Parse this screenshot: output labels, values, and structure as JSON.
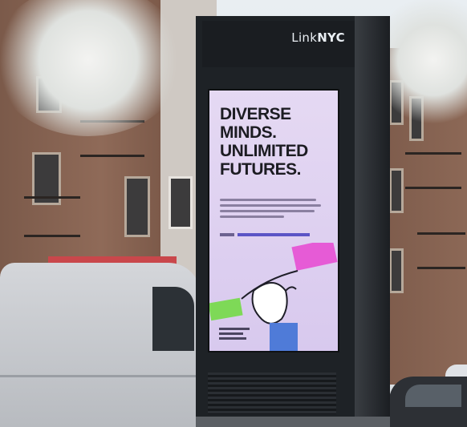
{
  "kiosk": {
    "brand_link": "Link",
    "brand_nyc": "NYC"
  },
  "ad": {
    "headline_1": "DIVERSE",
    "headline_2": "MINDS.",
    "headline_3": "UNLIMITED",
    "headline_4": "FUTURES."
  },
  "colors": {
    "screen_background": "#e2d6f3",
    "pink_hand": "#e65bd6",
    "green_hand": "#7ed957",
    "blue_sleeve": "#4f7bd8",
    "awning": "#c9474b"
  }
}
